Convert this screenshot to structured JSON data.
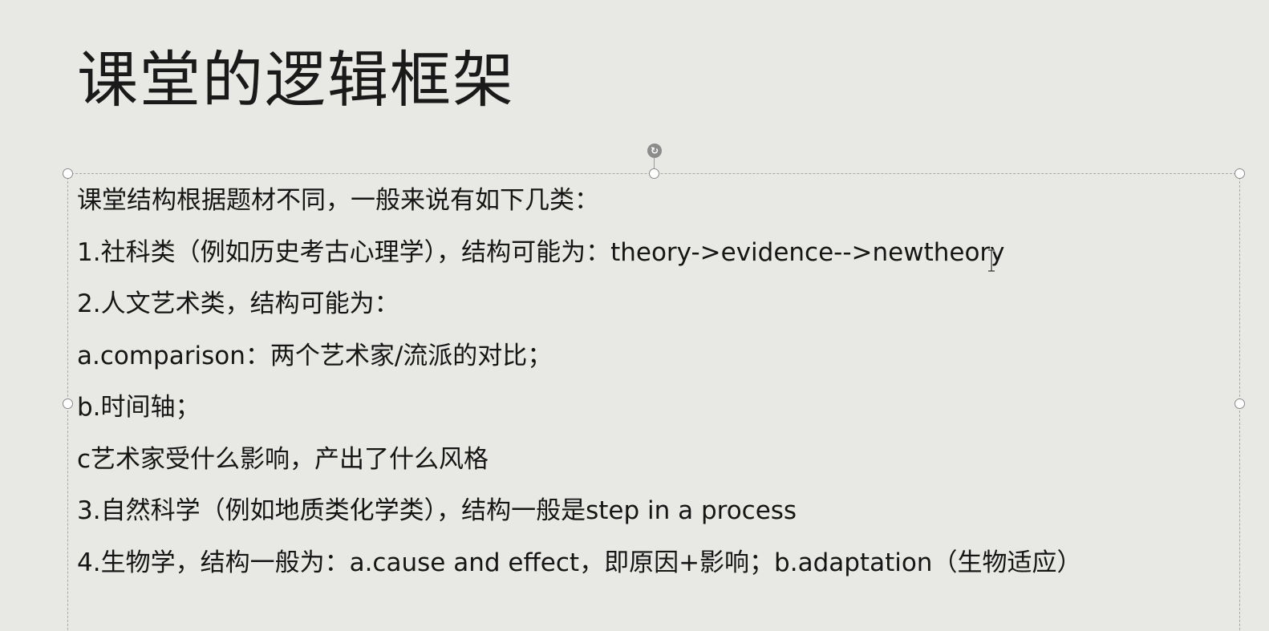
{
  "slide": {
    "title": "课堂的逻辑框架",
    "body_lines": [
      "课堂结构根据题材不同，一般来说有如下几类：",
      "1.社科类（例如历史考古心理学），结构可能为：theory->evidence-->newtheory",
      "2.人文艺术类，结构可能为：",
      "a.comparison：两个艺术家/流派的对比；",
      "b.时间轴；",
      "c艺术家受什么影响，产出了什么风格",
      "3.自然科学（例如地质类化学类），结构一般是step in a process",
      "4.生物学，结构一般为：a.cause and effect，即原因+影响；b.adaptation（生物适应）"
    ]
  },
  "icons": {
    "rotate_handle": "rotate-icon",
    "text_cursor": "i-beam-cursor-icon"
  },
  "colors": {
    "background": "#e8e9e4",
    "text": "#151515",
    "selection_border": "#a8a8a8",
    "rotate_handle": "#8c8c8c"
  }
}
